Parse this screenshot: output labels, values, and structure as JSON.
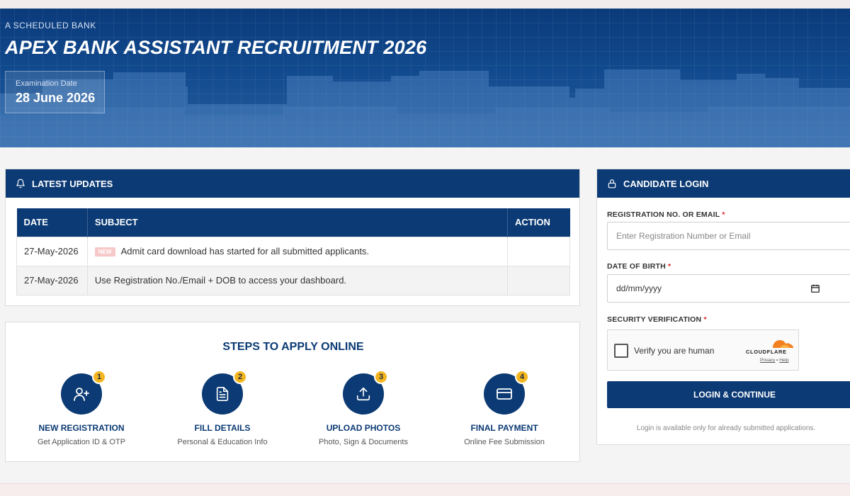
{
  "hero": {
    "eyebrow": "A SCHEDULED BANK",
    "title": "APEX BANK ASSISTANT RECRUITMENT 2026",
    "exam_date_label": "Examination Date",
    "exam_date": "28 June 2026"
  },
  "updates": {
    "header": "LATEST UPDATES",
    "columns": [
      "DATE",
      "SUBJECT",
      "ACTION"
    ],
    "rows": [
      {
        "date": "27-May-2026",
        "badge": "NEW",
        "subject": "Admit card download has started for all submitted applicants.",
        "action": ""
      },
      {
        "date": "27-May-2026",
        "badge": "",
        "subject": "Use Registration No./Email + DOB to access your dashboard.",
        "action": ""
      }
    ]
  },
  "steps": {
    "title": "STEPS TO APPLY ONLINE",
    "items": [
      {
        "num": "1",
        "title": "NEW REGISTRATION",
        "sub": "Get Application ID & OTP",
        "icon": "user-add-icon"
      },
      {
        "num": "2",
        "title": "FILL DETAILS",
        "sub": "Personal & Education Info",
        "icon": "document-icon"
      },
      {
        "num": "3",
        "title": "UPLOAD PHOTOS",
        "sub": "Photo, Sign & Documents",
        "icon": "upload-icon"
      },
      {
        "num": "4",
        "title": "FINAL PAYMENT",
        "sub": "Online Fee Submission",
        "icon": "card-icon"
      }
    ]
  },
  "login": {
    "header": "CANDIDATE LOGIN",
    "reg_label": "REGISTRATION NO. OR EMAIL",
    "reg_placeholder": "Enter Registration Number or Email",
    "dob_label": "DATE OF BIRTH",
    "dob_value": "dd/mm/yyyy",
    "security_label": "SECURITY VERIFICATION",
    "required_mark": "*",
    "captcha_text": "Verify you are human",
    "captcha_brand": "CLOUDFLARE",
    "captcha_privacy": "Privacy",
    "captcha_sep": "•",
    "captcha_help": "Help",
    "button": "LOGIN & CONTINUE",
    "note": "Login is available only for already submitted applications."
  },
  "colors": {
    "primary": "#0b3a74",
    "accent": "#f3b61f",
    "badge_new": "#f7c8c8",
    "cloudflare": "#f38020"
  }
}
